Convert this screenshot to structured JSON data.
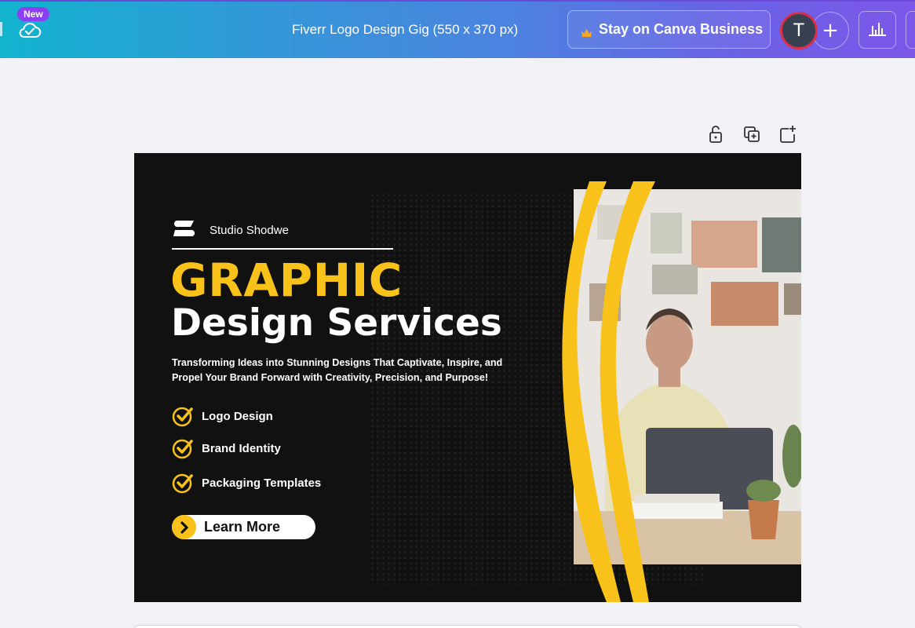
{
  "topbar": {
    "new_badge": "New",
    "cloud_icon": "cloud-check-icon",
    "doc_title": "Fiverr Logo Design Gig (550 x 370 px)",
    "business_button": "Stay on Canva Business",
    "avatar_initial": "T",
    "plus_label": "+",
    "colors": {
      "gradient_start": "#12b3cf",
      "gradient_end": "#7c57e8",
      "avatar_ring": "#d8324b"
    }
  },
  "page_tools": [
    "unlock-icon",
    "duplicate-page-icon",
    "add-page-icon"
  ],
  "design": {
    "brand_name": "Studio Shodwe",
    "headline_1": "GRAPHIC",
    "headline_2": "Design Services",
    "tagline": "Transforming Ideas into Stunning Designs That Captivate, Inspire, and Propel Your Brand Forward with Creativity, Precision, and Purpose!",
    "features": [
      "Logo Design",
      "Brand Identity",
      "Packaging Templates"
    ],
    "cta": "Learn More",
    "colors": {
      "accent": "#f8c21a",
      "background": "#111111",
      "text": "#ffffff"
    }
  }
}
